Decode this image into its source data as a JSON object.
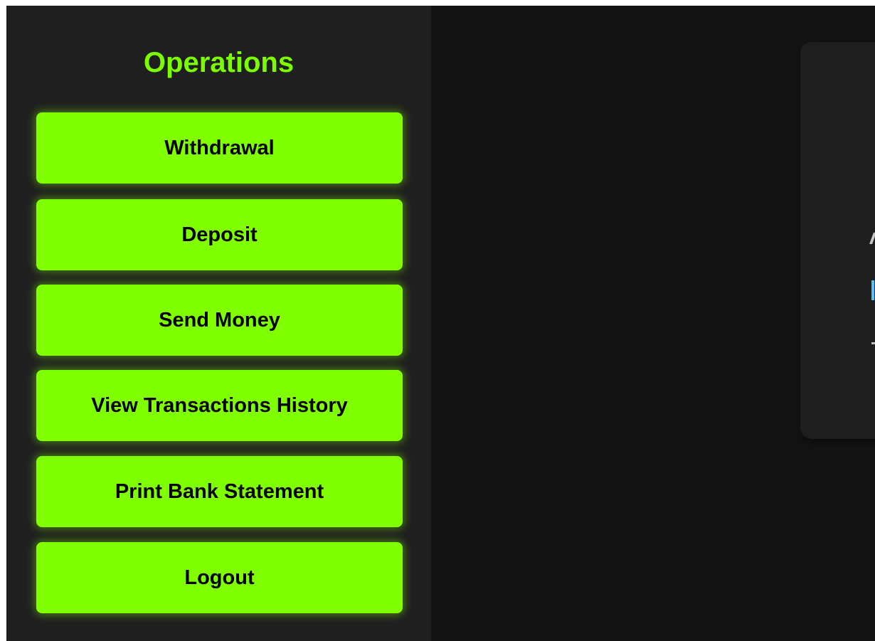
{
  "sidebar": {
    "title": "Operations",
    "buttons": [
      {
        "label": "Withdrawal"
      },
      {
        "label": "Deposit"
      },
      {
        "label": "Send Money"
      },
      {
        "label": "View Transactions History"
      },
      {
        "label": "Print Bank Statement"
      },
      {
        "label": "Logout"
      }
    ]
  },
  "colors": {
    "accent": "#80ff00",
    "title": "#7cfc00",
    "sidebar_bg": "#1f1f1f",
    "main_bg": "#141414",
    "card_bg": "#1e1e1e",
    "partial_text_blue": "#4fc3f7"
  }
}
